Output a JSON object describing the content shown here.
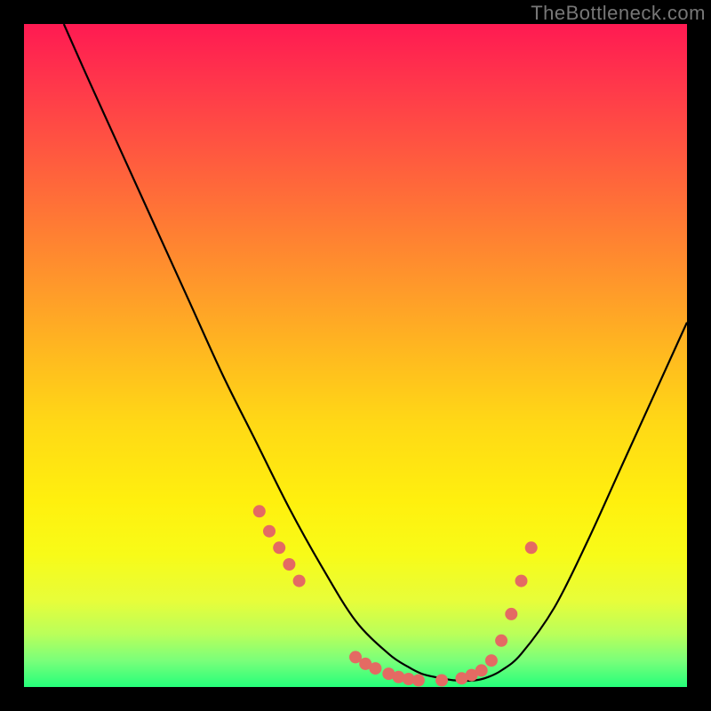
{
  "watermark": "TheBottleneck.com",
  "colors": {
    "page_bg": "#000000",
    "curve_stroke": "#000000",
    "dot_fill": "#e46a63",
    "gradient_top": "#ff1a52",
    "gradient_bottom": "#25ff7a"
  },
  "chart_data": {
    "type": "line",
    "title": "",
    "xlabel": "",
    "ylabel": "",
    "xlim": [
      0,
      100
    ],
    "ylim": [
      0,
      100
    ],
    "grid": false,
    "series": [
      {
        "name": "bottleneck-curve",
        "x": [
          6,
          10,
          15,
          20,
          25,
          30,
          35,
          40,
          45,
          50,
          55,
          58,
          60,
          62,
          65,
          68,
          70,
          72,
          75,
          80,
          85,
          90,
          95,
          100
        ],
        "y": [
          100,
          91,
          80,
          69,
          58,
          47,
          37,
          27,
          18,
          10,
          5,
          3,
          2,
          1.5,
          1,
          1,
          1.5,
          2.5,
          5,
          12,
          22,
          33,
          44,
          55
        ]
      }
    ],
    "highlight_points": {
      "name": "highlight-dots",
      "x": [
        35.5,
        37,
        38.5,
        40,
        41.5,
        50,
        51.5,
        53,
        55,
        56.5,
        58,
        59.5,
        63,
        66,
        67.5,
        69,
        70.5,
        72,
        73.5,
        75,
        76.5
      ],
      "y": [
        26.5,
        23.5,
        21,
        18.5,
        16,
        4.5,
        3.5,
        2.8,
        2,
        1.5,
        1.2,
        1,
        1,
        1.3,
        1.8,
        2.5,
        4,
        7,
        11,
        16,
        21
      ]
    }
  }
}
